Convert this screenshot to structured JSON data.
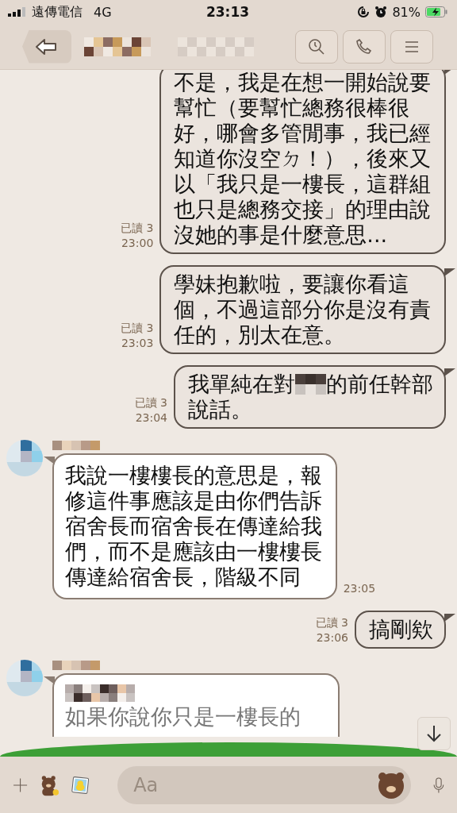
{
  "status_bar": {
    "carrier": "遠傳電信",
    "network": "4G",
    "time": "23:13",
    "battery": "81%",
    "charging": true
  },
  "messages": [
    {
      "kind": "sent",
      "text": "不是，我是在想一開始說要幫忙（要幫忙總務很棒很好，哪會多管閒事，我已經知道你沒空ㄉ！），後來又以「我只是一樓長，這群組也只是總務交接」的理由說沒她的事是什麼意思...",
      "read": "已讀 3",
      "time": "23:00"
    },
    {
      "kind": "sent",
      "text": "學妹抱歉啦，要讓你看這個，不過這部分你是沒有責任的，別太在意。",
      "read": "已讀 3",
      "time": "23:03"
    },
    {
      "kind": "sent",
      "text": "我單純在對",
      "text_after": "的前任幹部",
      "text_next_line": "說話。",
      "read": "已讀 3",
      "time": "23:04"
    },
    {
      "kind": "received",
      "text": "我說一樓樓長的意思是，報修這件事應該是由你們告訴宿舍長而宿舍長在傳達給我們，而不是應該由一樓樓長傳達給宿舍長，階級不同",
      "time": "23:05"
    },
    {
      "kind": "sent",
      "text": "搞剛欸",
      "read": "已讀 3",
      "time": "23:06"
    },
    {
      "kind": "reply",
      "text": "如果你說你只是一樓長的"
    }
  ],
  "input": {
    "placeholder": "Aa"
  }
}
